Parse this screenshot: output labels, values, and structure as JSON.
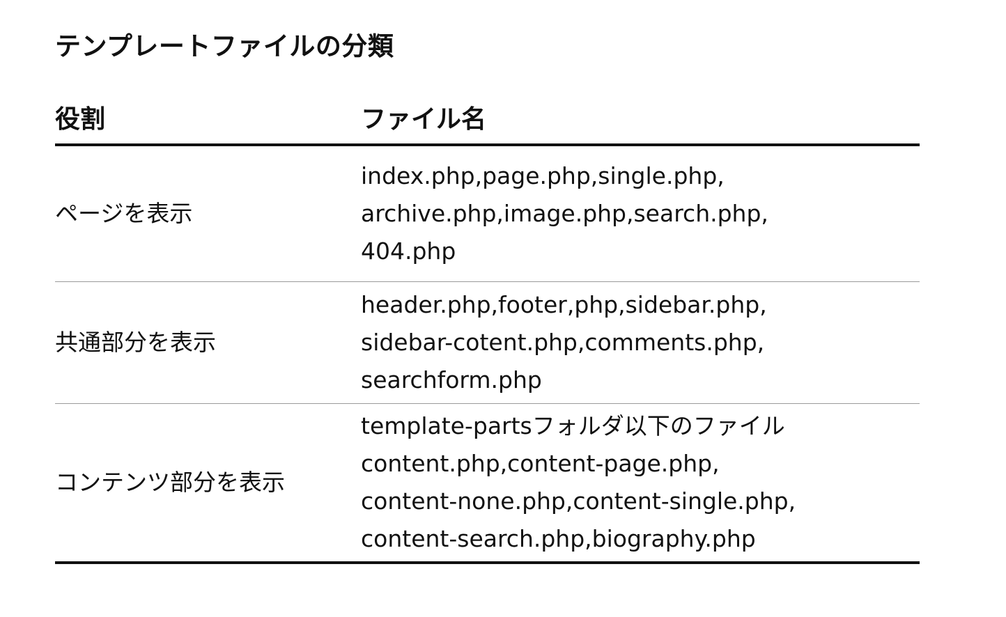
{
  "title": "テンプレートファイルの分類",
  "table": {
    "headers": [
      "役割",
      "ファイル名"
    ],
    "rows": [
      {
        "role": "ページを表示",
        "files": [
          "index.php,page.php,single.php,",
          "archive.php,image.php,search.php,",
          "404.php"
        ]
      },
      {
        "role": "共通部分を表示",
        "files": [
          "header.php,footer,php,sidebar.php,",
          "sidebar-cotent.php,comments.php,",
          "searchform.php"
        ]
      },
      {
        "role": "コンテンツ部分を表示",
        "files": [
          "template-partsフォルダ以下のファイル",
          "content.php,content-page.php,",
          "content-none.php,content-single.php,",
          "content-search.php,biography.php"
        ]
      }
    ]
  }
}
